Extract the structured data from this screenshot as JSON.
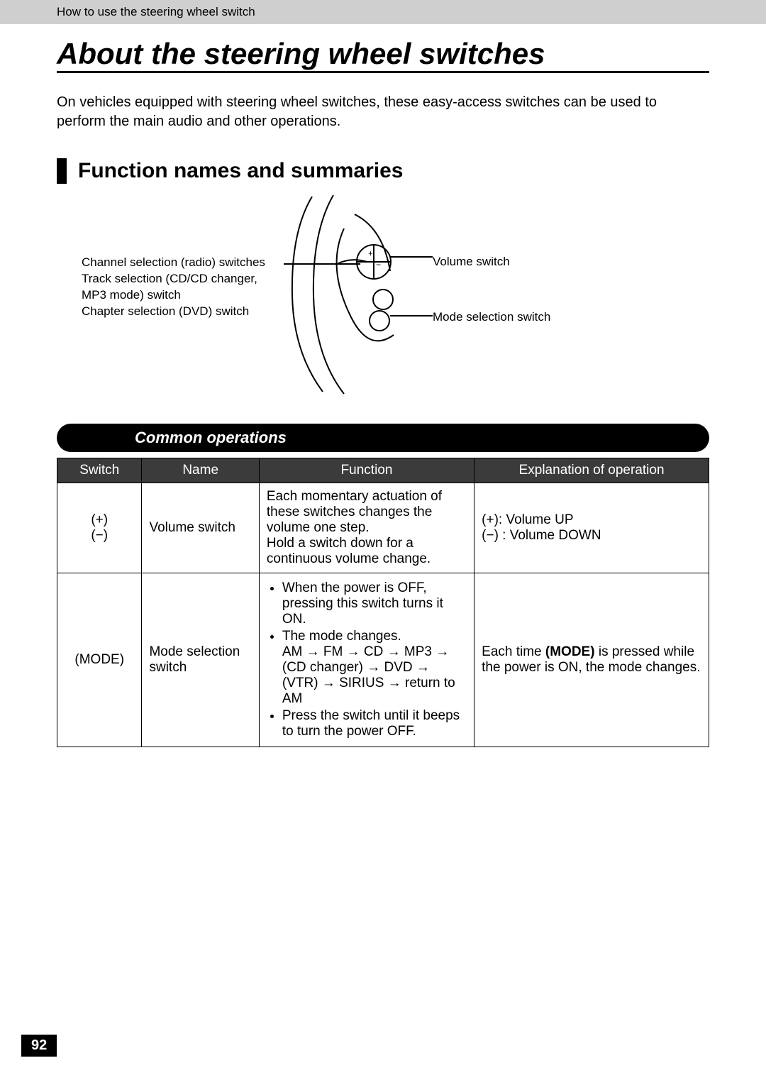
{
  "header": {
    "breadcrumb": "How to use the steering wheel switch"
  },
  "title": "About the steering wheel switches",
  "intro": "On vehicles equipped with steering wheel switches, these easy-access switches can be used to perform the main audio and other operations.",
  "section_heading": "Function names and summaries",
  "diagram": {
    "left_line1": "Channel selection (radio) switches",
    "left_line2": "Track selection (CD/CD changer,",
    "left_line3": "MP3 mode) switch",
    "left_line4": "Chapter selection (DVD) switch",
    "right_volume": "Volume switch",
    "right_mode": "Mode selection switch"
  },
  "pill": "Common operations",
  "table": {
    "headers": {
      "switch": "Switch",
      "name": "Name",
      "function": "Function",
      "explanation": "Explanation of operation"
    },
    "rows": [
      {
        "switch": "(+)\n(−)",
        "name": "Volume switch",
        "function": "Each momentary actuation of these switches changes the volume one step.\nHold a switch down for a continuous volume change.",
        "explanation_l1": "(+): Volume UP",
        "explanation_l2": "(−) : Volume DOWN"
      },
      {
        "switch": "(MODE)",
        "name": "Mode selection switch",
        "function_b1": "When the power is OFF, pressing this switch turns it ON.",
        "function_b2a": "The mode changes.",
        "function_b2b": "AM → FM → CD → MP3 → (CD changer) → DVD → (VTR) → SIRIUS → return to AM",
        "function_b3": "Press the switch until it beeps to turn the power OFF.",
        "explanation_pre": "Each time ",
        "explanation_bold": "(MODE)",
        "explanation_post": " is pressed while the power is ON, the mode changes."
      }
    ]
  },
  "page_number": "92"
}
